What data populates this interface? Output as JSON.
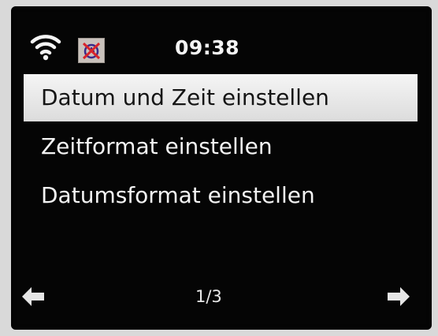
{
  "status_bar": {
    "time": "09:38",
    "wifi_icon": "wifi-icon",
    "alarm_icon": "alarm-off-icon"
  },
  "menu": {
    "items": [
      {
        "label": "Datum und Zeit einstellen",
        "selected": true
      },
      {
        "label": "Zeitformat einstellen",
        "selected": false
      },
      {
        "label": "Datumsformat einstellen",
        "selected": false
      }
    ]
  },
  "footer": {
    "page": "1/3",
    "prev_icon": "arrow-left-icon",
    "next_icon": "arrow-right-icon"
  },
  "colors": {
    "screen_bg": "#050505",
    "text": "#f4f4f4",
    "highlight_bg": "#eeeeee",
    "highlight_text": "#151515"
  }
}
